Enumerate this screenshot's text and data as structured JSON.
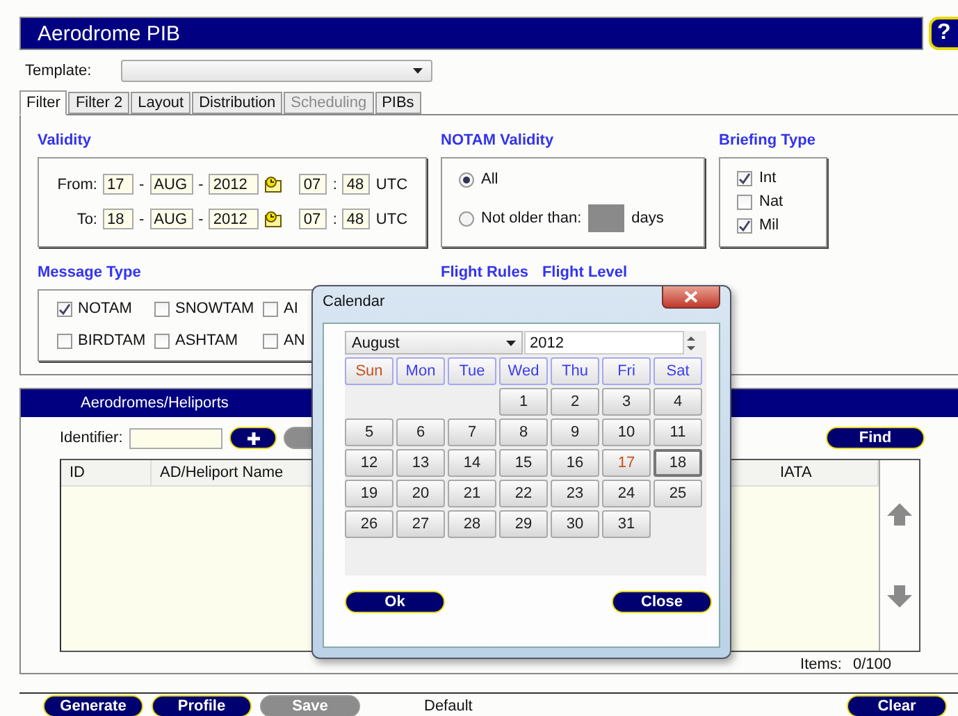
{
  "window": {
    "title": "Aerodrome PIB",
    "help": "?"
  },
  "template": {
    "label": "Template:"
  },
  "tabs": [
    {
      "label": "Filter",
      "selected": true,
      "disabled": false
    },
    {
      "label": "Filter 2",
      "selected": false,
      "disabled": false
    },
    {
      "label": "Layout",
      "selected": false,
      "disabled": false
    },
    {
      "label": "Distribution",
      "selected": false,
      "disabled": false
    },
    {
      "label": "Scheduling",
      "selected": false,
      "disabled": true
    },
    {
      "label": "PIBs",
      "selected": false,
      "disabled": false
    }
  ],
  "validity": {
    "title": "Validity",
    "rows": [
      {
        "label": "From:",
        "day": "17",
        "sep1": "-",
        "month": "AUG",
        "sep2": "-",
        "year": "2012",
        "hour": "07",
        "sep3": ":",
        "minute": "48",
        "zone": "UTC"
      },
      {
        "label": "To:",
        "day": "18",
        "sep1": "-",
        "month": "AUG",
        "sep2": "-",
        "year": "2012",
        "hour": "07",
        "sep3": ":",
        "minute": "48",
        "zone": "UTC"
      }
    ]
  },
  "notam_validity": {
    "title": "NOTAM Validity",
    "options": [
      {
        "label": "All",
        "selected": true
      },
      {
        "label": "Not older than:",
        "selected": false,
        "suffix": "days"
      }
    ]
  },
  "briefing_type": {
    "title": "Briefing Type",
    "options": [
      {
        "label": "Int",
        "checked": true
      },
      {
        "label": "Nat",
        "checked": false
      },
      {
        "label": "Mil",
        "checked": true
      }
    ]
  },
  "message_type": {
    "title": "Message Type",
    "options": [
      {
        "label": "NOTAM",
        "checked": true
      },
      {
        "label": "SNOWTAM",
        "checked": false
      },
      {
        "label": "AI",
        "checked": false
      },
      {
        "label": "BIRDTAM",
        "checked": false
      },
      {
        "label": "ASHTAM",
        "checked": false
      },
      {
        "label": "AN",
        "checked": false
      }
    ]
  },
  "flight_labels": [
    "Flight Rules",
    "Flight Level"
  ],
  "aerodromes": {
    "title": "Aerodromes/Heliports",
    "identifier_label": "Identifier:",
    "find_button": "Find",
    "columns": [
      {
        "label": "ID",
        "kind": "left"
      },
      {
        "label": "AD/Heliport Name",
        "kind": "left"
      },
      {
        "label": "IATA",
        "kind": "right"
      }
    ],
    "items_label": "Items:",
    "items_value": "0/100"
  },
  "footer": {
    "buttons": [
      {
        "label": "Generate",
        "disabled": false
      },
      {
        "label": "Profile",
        "disabled": false
      },
      {
        "label": "Save",
        "disabled": true
      }
    ],
    "profile": "Default",
    "clear_button": "Clear"
  },
  "calendar": {
    "title": "Calendar",
    "month": "August",
    "year": "2012",
    "ok_button": "Ok",
    "close_button": "Close",
    "weekdays": [
      {
        "label": "Sun",
        "color": "#c8501e"
      },
      {
        "label": "Mon",
        "color": "#3c3cf0"
      },
      {
        "label": "Tue",
        "color": "#3c3cf0"
      },
      {
        "label": "Wed",
        "color": "#3c3cf0"
      },
      {
        "label": "Thu",
        "color": "#3c3cf0"
      },
      {
        "label": "Fri",
        "color": "#3c3cf0"
      },
      {
        "label": "Sat",
        "color": "#3c3cf0"
      }
    ],
    "weeks": [
      [
        {
          "label": "1",
          "selected": false,
          "today": false
        },
        {
          "label": "2",
          "selected": false,
          "today": false
        },
        {
          "label": "3",
          "selected": false,
          "today": false
        },
        {
          "label": "4",
          "selected": false,
          "today": false
        }
      ],
      [
        {
          "label": "5",
          "selected": false,
          "today": false
        },
        {
          "label": "6",
          "selected": false,
          "today": false
        },
        {
          "label": "7",
          "selected": false,
          "today": false
        },
        {
          "label": "8",
          "selected": false,
          "today": false
        },
        {
          "label": "9",
          "selected": false,
          "today": false
        },
        {
          "label": "10",
          "selected": false,
          "today": false
        },
        {
          "label": "11",
          "selected": false,
          "today": false
        }
      ],
      [
        {
          "label": "12",
          "selected": false,
          "today": false
        },
        {
          "label": "13",
          "selected": false,
          "today": false
        },
        {
          "label": "14",
          "selected": false,
          "today": false
        },
        {
          "label": "15",
          "selected": false,
          "today": false
        },
        {
          "label": "16",
          "selected": false,
          "today": false
        },
        {
          "label": "17",
          "selected": false,
          "today": true
        },
        {
          "label": "18",
          "selected": true,
          "today": false
        }
      ],
      [
        {
          "label": "19",
          "selected": false,
          "today": false
        },
        {
          "label": "20",
          "selected": false,
          "today": false
        },
        {
          "label": "21",
          "selected": false,
          "today": false
        },
        {
          "label": "22",
          "selected": false,
          "today": false
        },
        {
          "label": "23",
          "selected": false,
          "today": false
        },
        {
          "label": "24",
          "selected": false,
          "today": false
        },
        {
          "label": "25",
          "selected": false,
          "today": false
        }
      ],
      [
        {
          "label": "26",
          "selected": false,
          "today": false
        },
        {
          "label": "27",
          "selected": false,
          "today": false
        },
        {
          "label": "28",
          "selected": false,
          "today": false
        },
        {
          "label": "29",
          "selected": false,
          "today": false
        },
        {
          "label": "30",
          "selected": false,
          "today": false
        },
        {
          "label": "31",
          "selected": false,
          "today": false
        }
      ]
    ]
  }
}
